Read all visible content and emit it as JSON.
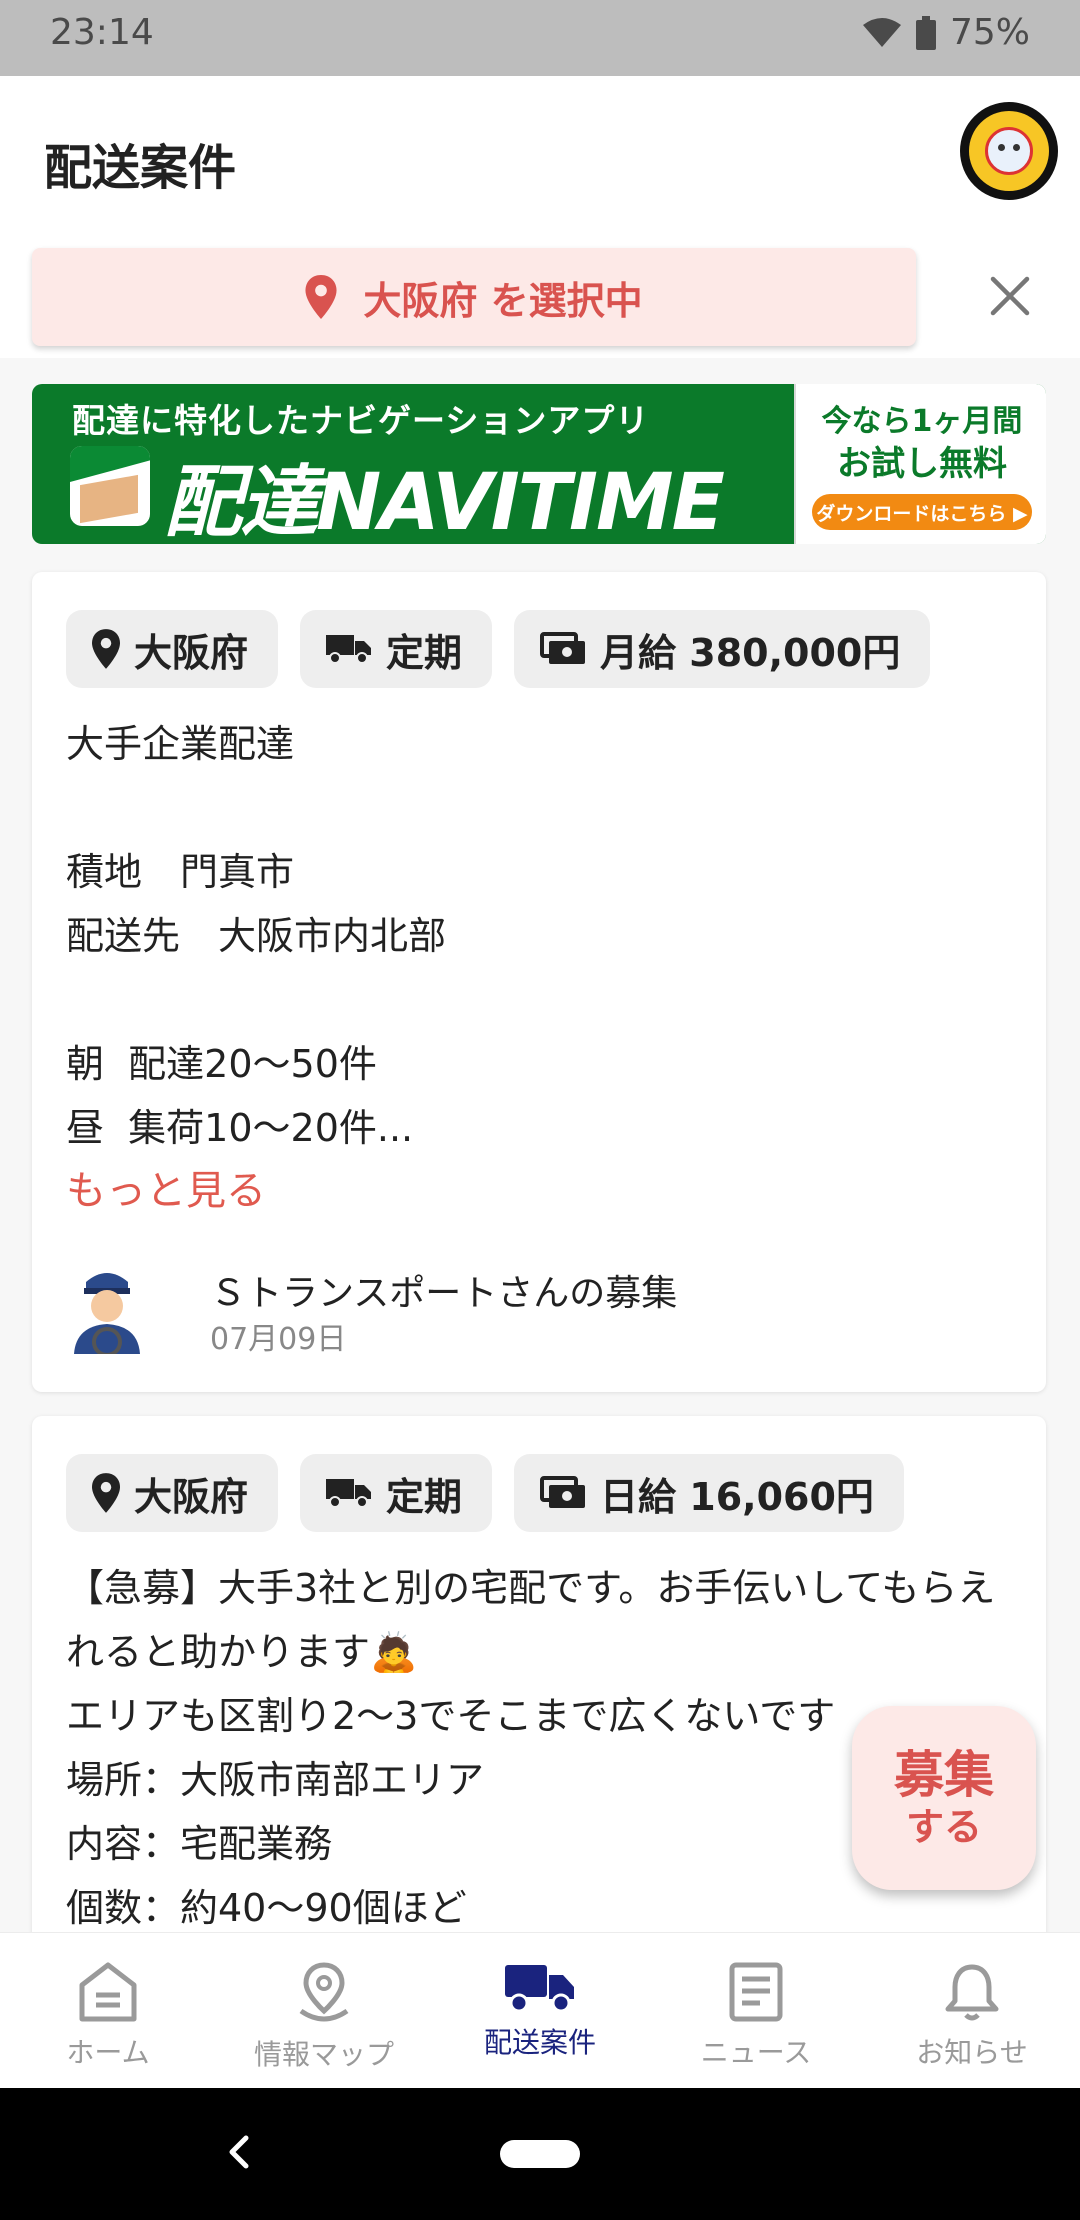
{
  "status": {
    "time": "23:14",
    "battery": "75%"
  },
  "header": {
    "title": "配送案件"
  },
  "region_filter": {
    "label": "大阪府 を選択中",
    "accent": "#d9534f"
  },
  "banner": {
    "tagline": "配達に特化したナビゲーションアプリ",
    "brand": "配達NAVITIME",
    "promo_line1": "今なら1ヶ月間",
    "promo_line2": "お試し無料",
    "cta": "ダウンロードはこちら ▶"
  },
  "jobs": [
    {
      "tags": {
        "prefecture": "大阪府",
        "type": "定期",
        "pay": "月給 380,000円"
      },
      "description": "大手企業配達\n\n積地　門真市\n配送先　大阪市内北部\n\n朝  配達20〜50件\n昼  集荷10〜20件...",
      "more": "もっと見る",
      "poster": "Ｓトランスポートさんの募集",
      "date": "07月09日"
    },
    {
      "tags": {
        "prefecture": "大阪府",
        "type": "定期",
        "pay": "日給 16,060円"
      },
      "description": "【急募】大手3社と別の宅配です。お手伝いしてもらえれると助かります🙇\nエリアも区割り2〜3でそこまで広くないです\n場所：大阪市南部エリア\n内容：宅配業務\n個数：約40〜90個ほど"
    }
  ],
  "fab": {
    "line1": "募集",
    "line2": "する"
  },
  "nav": {
    "items": [
      {
        "label": "ホーム",
        "icon": "home-icon"
      },
      {
        "label": "情報マップ",
        "icon": "map-pin-icon"
      },
      {
        "label": "配送案件",
        "icon": "truck-icon"
      },
      {
        "label": "ニュース",
        "icon": "news-icon"
      },
      {
        "label": "お知らせ",
        "icon": "bell-icon"
      }
    ],
    "active_color": "#1a237e"
  }
}
